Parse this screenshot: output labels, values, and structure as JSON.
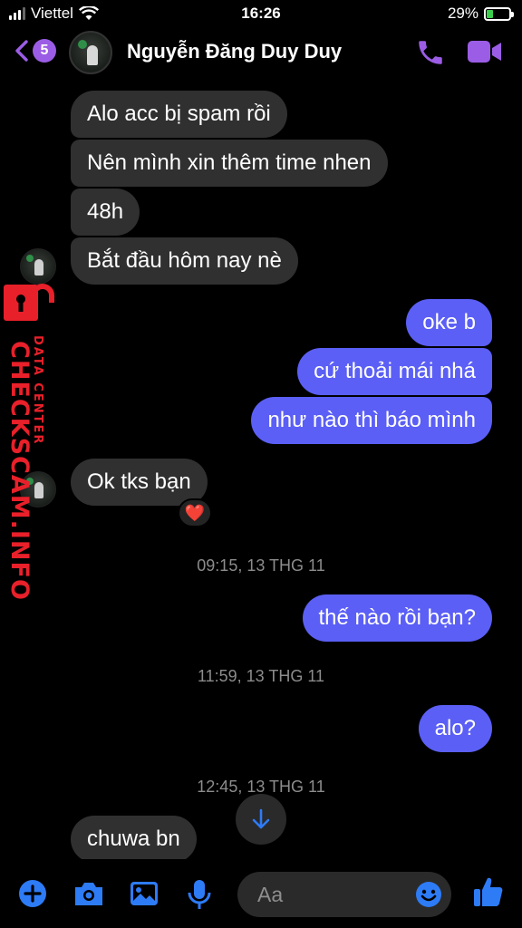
{
  "status_bar": {
    "carrier": "Viettel",
    "time": "16:26",
    "battery_percent": "29%",
    "battery_level": 0.29,
    "signal_bars": 3
  },
  "header": {
    "back_badge": "5",
    "contact_name": "Nguyễn Đăng Duy Duy",
    "icons": [
      "chevron-left-icon",
      "phone-icon",
      "video-camera-icon"
    ],
    "accent_color": "#9b5de5"
  },
  "messages": [
    {
      "side": "in",
      "text": "Alo acc bị spam rồi"
    },
    {
      "side": "in",
      "text": "Nên mình xin thêm time nhen"
    },
    {
      "side": "in",
      "text": "48h"
    },
    {
      "side": "in",
      "text": "Bắt đầu hôm nay nè"
    },
    {
      "side": "out",
      "text": "oke b"
    },
    {
      "side": "out",
      "text": "cứ thoải mái nhá"
    },
    {
      "side": "out",
      "text": "như nào thì báo mình"
    },
    {
      "side": "in",
      "text": "Ok tks bạn",
      "reaction": "❤️"
    },
    {
      "side": "out",
      "text": "thế nào rồi bạn?"
    },
    {
      "side": "out",
      "text": "alo?"
    },
    {
      "side": "in",
      "text": "chuwa bn"
    }
  ],
  "timestamps": [
    "09:15, 13 THG 11",
    "11:59, 13 THG 11",
    "12:45, 13 THG 11"
  ],
  "watermark": {
    "brand": "CHECKSCAM.INFO",
    "sub": "DATA CENTER",
    "color": "#e8202a"
  },
  "composer": {
    "placeholder": "Aa",
    "icons": [
      "plus-circle-icon",
      "camera-icon",
      "photo-icon",
      "microphone-icon",
      "emoji-icon",
      "thumbs-up-icon"
    ],
    "icon_color": "#2e7bf6"
  },
  "colors": {
    "incoming_bubble": "#303030",
    "outgoing_bubble": "#5b5ff5",
    "background": "#000000"
  }
}
